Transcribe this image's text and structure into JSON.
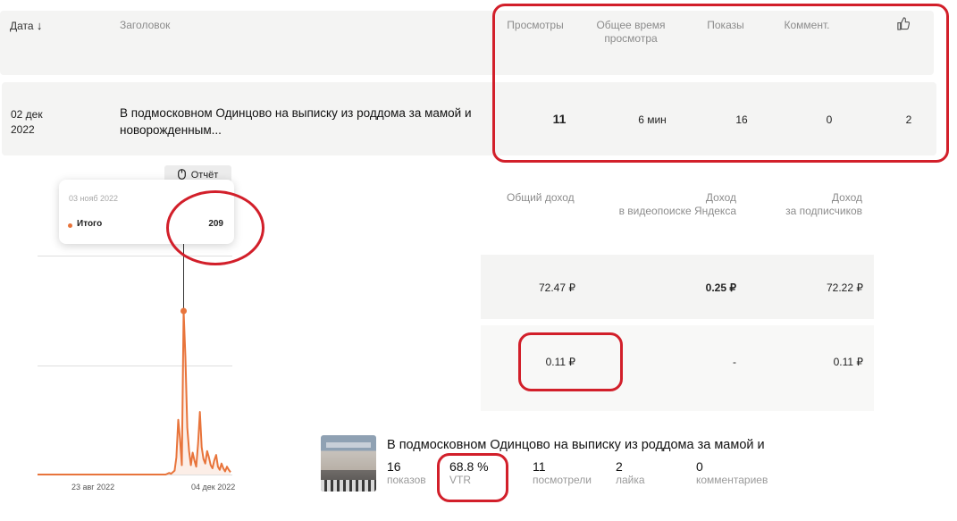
{
  "table": {
    "headers": {
      "date": "Дата",
      "title": "Заголовок",
      "views": "Просмотры",
      "watch_time_1": "Общее время",
      "watch_time_2": "просмотра",
      "impressions": "Показы",
      "comments": "Коммент."
    },
    "row": {
      "date_1": "02 дек",
      "date_2": "2022",
      "title_1": "В подмосковном Одинцово на выписку из роддома за мамой и",
      "title_2": "новорожденным...",
      "views": "11",
      "watch_time": "6 мин",
      "impressions": "16",
      "comments": "0",
      "likes": "2"
    }
  },
  "report_button": {
    "label": "Отчёт"
  },
  "tooltip": {
    "date": "03 нояб 2022",
    "series": "Итого",
    "value": "209"
  },
  "revenue": {
    "headers": {
      "total": "Общий доход",
      "yandex_1": "Доход",
      "yandex_2": "в видеопоиске Яндекса",
      "subs_1": "Доход",
      "subs_2": "за подписчиков"
    },
    "rows": [
      {
        "total": "72.47 ₽",
        "yandex": "0.25 ₽",
        "subs": "72.22 ₽"
      },
      {
        "total": "0.11 ₽",
        "yandex": "-",
        "subs": "0.11 ₽"
      }
    ]
  },
  "chart_data": {
    "type": "line",
    "color": "#e8743b",
    "x_labels": [
      "23 авг 2022",
      "04 дек 2022"
    ],
    "highlight_value": 209,
    "values": [
      0,
      0,
      0,
      0,
      0,
      0,
      0,
      0,
      0,
      0,
      0,
      0,
      0,
      0,
      0,
      0,
      0,
      0,
      0,
      0,
      0,
      0,
      0,
      0,
      0,
      0,
      0,
      0,
      0,
      0,
      0,
      0,
      0,
      0,
      0,
      0,
      0,
      0,
      0,
      0,
      0,
      0,
      0,
      0,
      0,
      0,
      0,
      0,
      0,
      0,
      0,
      0,
      0,
      0,
      0,
      0,
      0,
      0,
      0,
      0,
      0,
      0,
      0,
      0,
      0,
      0,
      0,
      0,
      0,
      0,
      0,
      0,
      1,
      2,
      1,
      3,
      5,
      22,
      70,
      45,
      12,
      209,
      150,
      60,
      30,
      12,
      28,
      18,
      10,
      40,
      80,
      35,
      20,
      14,
      30,
      22,
      12,
      8,
      18,
      25,
      10,
      6,
      14,
      8,
      4,
      10,
      6,
      3
    ]
  },
  "video_card": {
    "title": "В подмосковном Одинцово на выписку из роддома за мамой и",
    "stats": [
      {
        "value": "16",
        "label": "показов"
      },
      {
        "value": "68.8 %",
        "label": "VTR"
      },
      {
        "value": "11",
        "label": "посмотрели"
      },
      {
        "value": "2",
        "label": "лайка"
      },
      {
        "value": "0",
        "label": "комментариев"
      }
    ]
  }
}
